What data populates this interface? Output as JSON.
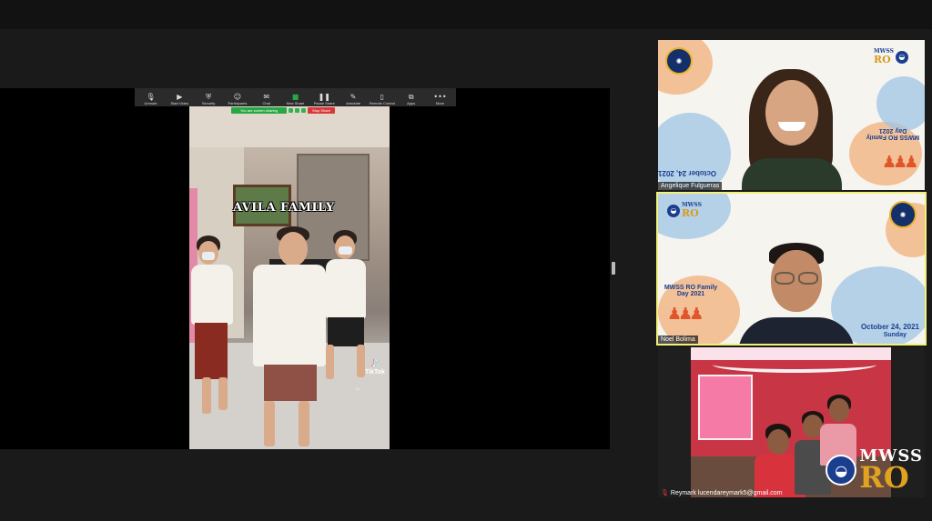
{
  "toolbar": {
    "items": [
      {
        "label": "Unmute",
        "icon": "microphone-off-icon"
      },
      {
        "label": "Start Video",
        "icon": "video-off-icon"
      },
      {
        "label": "Security",
        "icon": "shield-icon"
      },
      {
        "label": "Participants",
        "icon": "participants-icon"
      },
      {
        "label": "Chat",
        "icon": "chat-icon"
      },
      {
        "label": "New Share",
        "icon": "share-screen-icon"
      },
      {
        "label": "Pause Share",
        "icon": "pause-icon"
      },
      {
        "label": "Annotate",
        "icon": "pen-icon"
      },
      {
        "label": "Remote Control",
        "icon": "remote-control-icon"
      },
      {
        "label": "Apps",
        "icon": "apps-icon"
      },
      {
        "label": "More",
        "icon": "more-icon"
      }
    ]
  },
  "share_banner": {
    "status": "You are screen sharing",
    "stop_label": "Stop Share"
  },
  "shared_video": {
    "title": "AVILA FAMILY",
    "watermark": "TikTok",
    "handle": "@"
  },
  "participants": [
    {
      "name": "Angelique Fulgueras",
      "event_title": "MWSS RO Family Day 2021",
      "event_date": "October 24, 2021",
      "logo_top": "MWSS",
      "logo_bottom": "RO"
    },
    {
      "name": "Noel Bolima",
      "event_title": "MWSS RO Family Day 2021",
      "event_date": "October 24, 2021",
      "event_day": "Sunday",
      "logo_top": "MWSS",
      "logo_bottom": "RO",
      "active_speaker": true
    },
    {
      "name": "Reymark lucendareymark5@gmail.com",
      "logo_top": "MWSS",
      "logo_bottom": "RO",
      "muted": true
    }
  ],
  "colors": {
    "active_speaker_border": "#f1f17a",
    "share_banner_green": "#27a844",
    "stop_share_red": "#d9383a",
    "mwss_blue": "#1a3f8e",
    "mwss_gold": "#d99a1d"
  }
}
